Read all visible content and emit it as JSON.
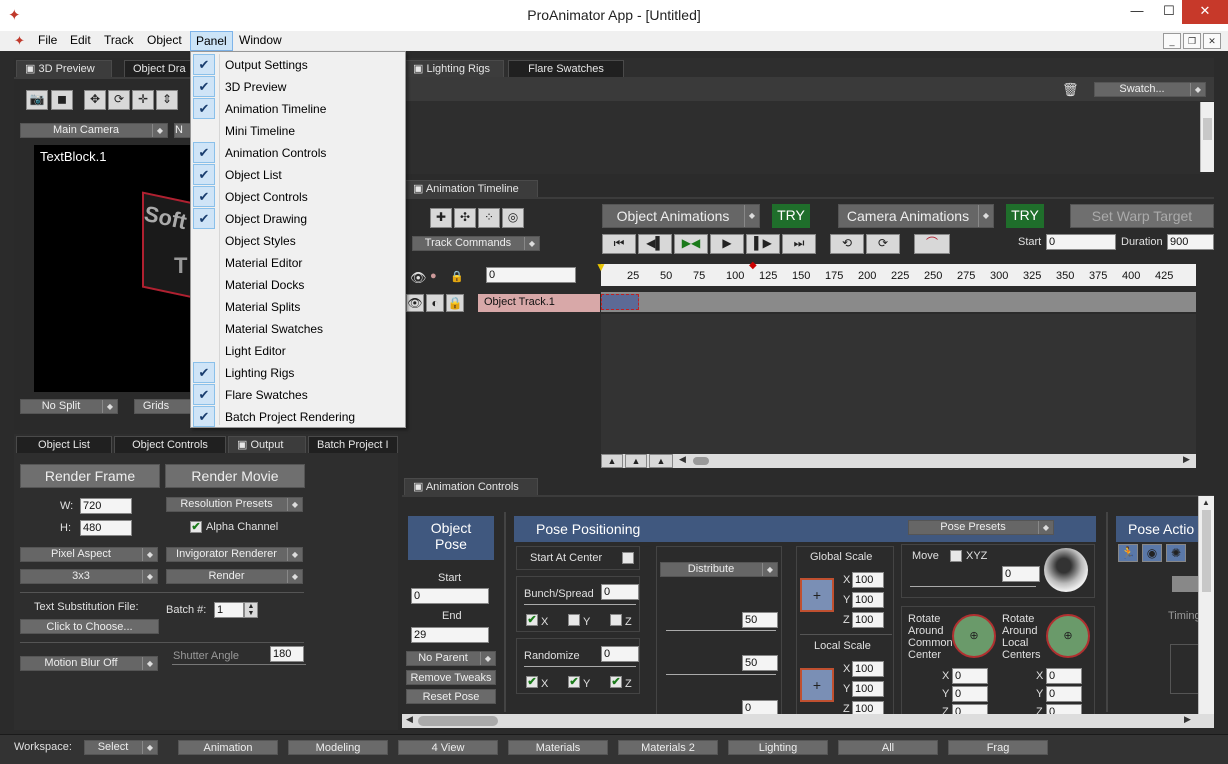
{
  "window": {
    "title": "ProAnimator App - [Untitled]",
    "min": "—",
    "max": "☐",
    "close": "✕"
  },
  "mdi": {
    "min": "_",
    "restore": "❐",
    "close": "✕"
  },
  "menubar": {
    "items": [
      "File",
      "Edit",
      "Track",
      "Object",
      "Panel",
      "Window"
    ]
  },
  "panel_menu": {
    "items": [
      {
        "label": "Output Settings",
        "checked": true
      },
      {
        "label": "3D Preview",
        "checked": true
      },
      {
        "label": "Animation Timeline",
        "checked": true
      },
      {
        "label": "Mini Timeline",
        "checked": false
      },
      {
        "label": "Animation Controls",
        "checked": true
      },
      {
        "label": "Object List",
        "checked": true
      },
      {
        "label": "Object Controls",
        "checked": true
      },
      {
        "label": "Object Drawing",
        "checked": true
      },
      {
        "label": "Object Styles",
        "checked": false
      },
      {
        "label": "Material Editor",
        "checked": false
      },
      {
        "label": "Material Docks",
        "checked": false
      },
      {
        "label": "Material Splits",
        "checked": false
      },
      {
        "label": "Material Swatches",
        "checked": false
      },
      {
        "label": "Light Editor",
        "checked": false
      },
      {
        "label": "Lighting Rigs",
        "checked": true
      },
      {
        "label": "Flare Swatches",
        "checked": true
      },
      {
        "label": "Batch Project Rendering",
        "checked": true
      }
    ],
    "check_glyph": "✔"
  },
  "preview": {
    "tabs": [
      "3D Preview",
      "Object Dra"
    ],
    "camera": "Main Camera",
    "object_name": "TextBlock.1",
    "split": "No Split",
    "grids": "Grids",
    "canvas_text1": "Soft",
    "canvas_text2": "T"
  },
  "swatches": {
    "tabs": [
      "Lighting Rigs",
      "Flare Swatches"
    ],
    "swatch_dd": "Swatch...",
    "trash_icon": "🗑"
  },
  "timeline": {
    "tab": "Animation Timeline",
    "object_anims": "Object Animations",
    "camera_anims": "Camera Animations",
    "try1": "TRY",
    "try2": "TRY",
    "warp": "Set Warp Target",
    "track_commands": "Track Commands",
    "start_label": "Start",
    "start_value": "0",
    "duration_label": "Duration",
    "duration_value": "900",
    "frame_value": "0",
    "ruler": [
      "25",
      "50",
      "75",
      "100",
      "125",
      "150",
      "175",
      "200",
      "225",
      "250",
      "275",
      "300",
      "325",
      "350",
      "375",
      "400",
      "425"
    ],
    "track_name": "Object Track.1",
    "transport": [
      "⏮",
      "◀▌",
      "▶◀",
      "▶",
      "▌▶",
      "⏭"
    ]
  },
  "object_panel": {
    "tabs": [
      "Object List",
      "Object Controls",
      "Output",
      "Batch Project I"
    ],
    "render_frame": "Render Frame",
    "render_movie": "Render Movie",
    "w_label": "W:",
    "w_value": "720",
    "h_label": "H:",
    "h_value": "480",
    "resolution_presets": "Resolution Presets",
    "alpha_channel": "Alpha Channel",
    "pixel_aspect": "Pixel Aspect",
    "renderer": "Invigorator Renderer",
    "aa": "3x3",
    "render": "Render",
    "subst_label": "Text Substitution File:",
    "click_choose": "Click to Choose...",
    "batch_label": "Batch #:",
    "batch_value": "1",
    "motion_blur": "Motion Blur Off",
    "shutter_label": "Shutter Angle",
    "shutter_value": "180"
  },
  "anim_controls": {
    "tab": "Animation Controls",
    "object_pose": "Object\nPose",
    "start_label": "Start",
    "start_value": "0",
    "end_label": "End",
    "end_value": "29",
    "no_parent": "No Parent",
    "remove_tweaks": "Remove Tweaks",
    "reset_pose": "Reset Pose",
    "pose_positioning": "Pose Positioning",
    "pose_presets": "Pose Presets",
    "start_at_center": "Start At Center",
    "bunch_spread": "Bunch/Spread",
    "bunch_value": "0",
    "randomize": "Randomize",
    "randomize_value": "0",
    "x": "X",
    "y": "Y",
    "z": "Z",
    "distribute": "Distribute",
    "dist_values": [
      "50",
      "50",
      "0"
    ],
    "global_scale": "Global Scale",
    "local_scale": "Local Scale",
    "scale_values": [
      "100",
      "100",
      "100"
    ],
    "local_values": [
      "100",
      "100",
      "100"
    ],
    "move": "Move",
    "xyz": "XYZ",
    "move_value": "0",
    "rotate_common": "Rotate\nAround\nCommon\nCenter",
    "rotate_local": "Rotate\nAround\nLocal\nCenters",
    "rot_values": [
      "0",
      "0",
      "0"
    ],
    "pose_actions": "Pose Actio",
    "timing": "Timing"
  },
  "workspace": {
    "label": "Workspace:",
    "select": "Select",
    "buttons": [
      "Animation",
      "Modeling",
      "4 View",
      "Materials",
      "Materials 2",
      "Lighting",
      "All",
      "Frag"
    ]
  }
}
